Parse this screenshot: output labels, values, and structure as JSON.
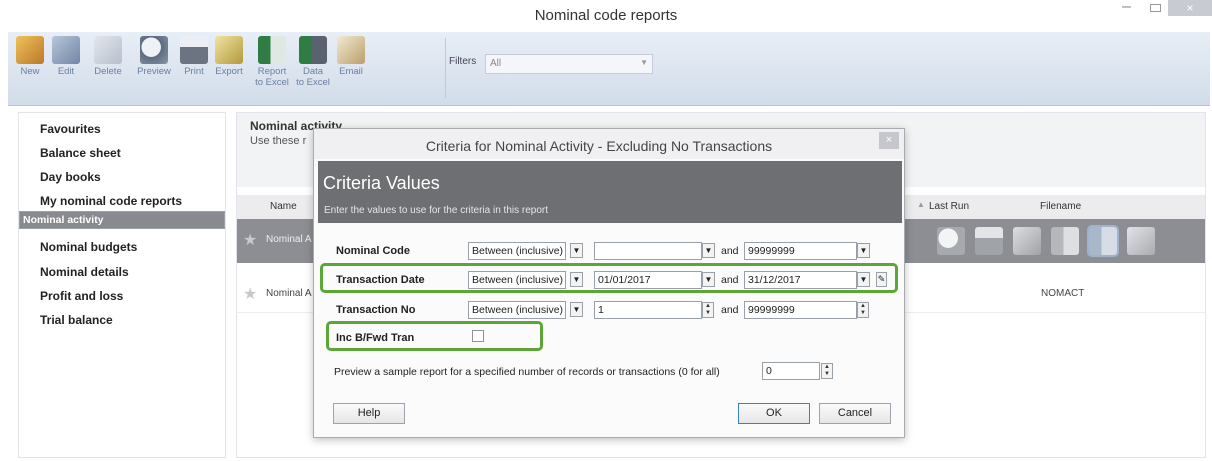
{
  "window": {
    "title": "Nominal code reports",
    "minimize": "–",
    "close": "×"
  },
  "toolbar": {
    "buttons": [
      {
        "line1": "New",
        "line2": "",
        "icon": "new-folder-icon",
        "color": "#d9a23a"
      },
      {
        "line1": "Edit",
        "line2": "",
        "icon": "edit-icon",
        "color": "#8aa0bd"
      },
      {
        "line1": "Delete",
        "line2": "",
        "icon": "delete-icon",
        "color": "#c6ccd6"
      },
      {
        "line1": "Preview",
        "line2": "",
        "icon": "preview-icon",
        "color": "#6d7e96"
      },
      {
        "line1": "Print",
        "line2": "",
        "icon": "printer-icon",
        "color": "#7c8594"
      },
      {
        "line1": "Export",
        "line2": "",
        "icon": "export-icon",
        "color": "#c9b25a"
      },
      {
        "line1": "Report",
        "line2": "to Excel",
        "icon": "excel-report-icon",
        "color": "#3f8a52"
      },
      {
        "line1": "Data",
        "line2": "to Excel",
        "icon": "excel-data-icon",
        "color": "#357a47"
      },
      {
        "line1": "Email",
        "line2": "",
        "icon": "email-icon",
        "color": "#b9a57a"
      }
    ],
    "filters_label": "Filters",
    "filters_value": "All"
  },
  "sidebar": {
    "items": [
      {
        "label": "Favourites",
        "selected": false
      },
      {
        "label": "Balance sheet",
        "selected": false
      },
      {
        "label": "Day books",
        "selected": false
      },
      {
        "label": "My nominal code reports",
        "selected": false
      },
      {
        "label": "Nominal activity",
        "selected": true
      },
      {
        "label": "Nominal budgets",
        "selected": false
      },
      {
        "label": "Nominal details",
        "selected": false
      },
      {
        "label": "Profit and loss",
        "selected": false
      },
      {
        "label": "Trial balance",
        "selected": false
      }
    ]
  },
  "main": {
    "title": "Nominal activity",
    "subtitle": "Use these r",
    "columns": {
      "name": "Name",
      "last_run": "Last Run",
      "filename": "Filename"
    },
    "rows": [
      {
        "name": "Nominal A",
        "filename": ""
      },
      {
        "name": "Nominal A",
        "filename": "NOMACT"
      }
    ]
  },
  "dialog": {
    "title": "Criteria for Nominal Activity - Excluding No Transactions",
    "close": "×",
    "heading": "Criteria Values",
    "subheading": "Enter the values to use for the criteria in this report",
    "criteria": [
      {
        "label": "Nominal Code",
        "operator": "Between (inclusive)",
        "from": "",
        "and": "and",
        "to": "99999999"
      },
      {
        "label": "Transaction Date",
        "operator": "Between (inclusive)",
        "from": "01/01/2017",
        "and": "and",
        "to": "31/12/2017"
      },
      {
        "label": "Transaction No",
        "operator": "Between (inclusive)",
        "from": "1",
        "and": "and",
        "to": "99999999"
      }
    ],
    "inc_bfwd_label": "Inc B/Fwd Tran",
    "inc_bfwd_checked": false,
    "sample_text": "Preview a sample report for a specified number of records or transactions (0 for all)",
    "sample_value": "0",
    "help": "Help",
    "ok": "OK",
    "cancel": "Cancel"
  },
  "highlight_color": "#5ca537"
}
